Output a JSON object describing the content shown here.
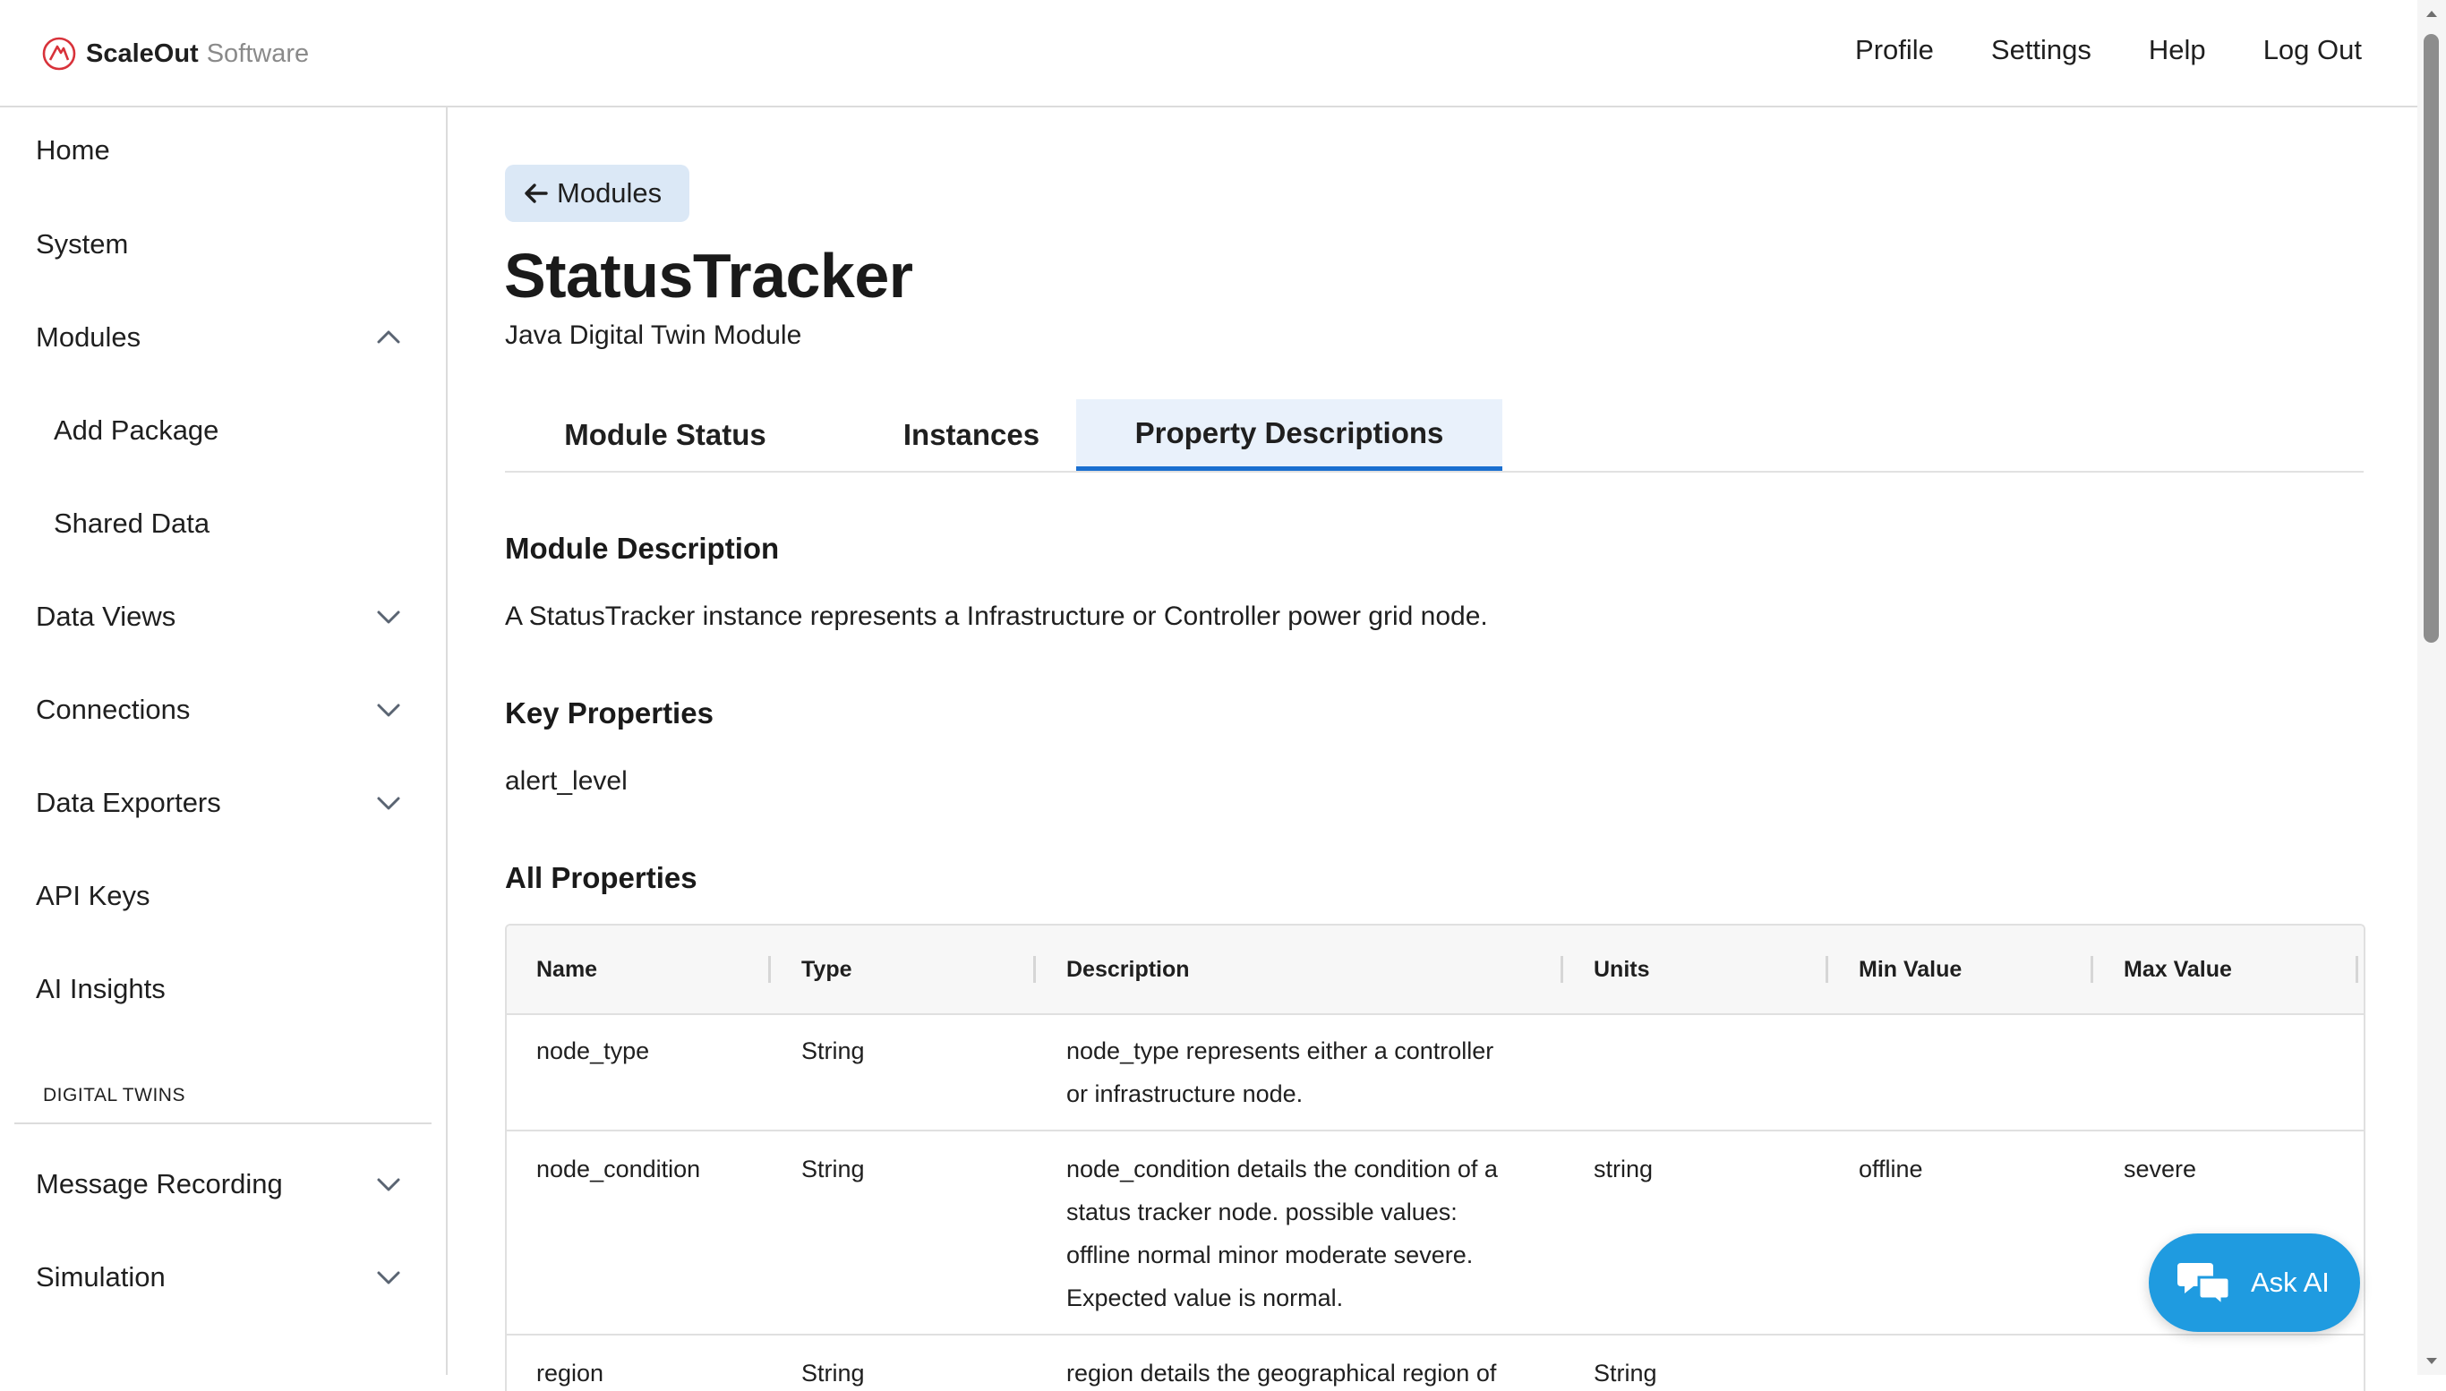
{
  "brand": {
    "name_bold": "ScaleOut",
    "name_light": "Software",
    "logo_color": "#d8323a"
  },
  "topnav": {
    "profile": "Profile",
    "settings": "Settings",
    "help": "Help",
    "logout": "Log Out"
  },
  "sidebar": {
    "items": [
      {
        "label": "Home"
      },
      {
        "label": "System"
      },
      {
        "label": "Modules",
        "expanded": true
      },
      {
        "label": "Add Package"
      },
      {
        "label": "Shared Data"
      },
      {
        "label": "Data Views"
      },
      {
        "label": "Connections"
      },
      {
        "label": "Data Exporters"
      },
      {
        "label": "API Keys"
      },
      {
        "label": "AI Insights"
      }
    ],
    "section_label": "DIGITAL TWINS",
    "section_items": [
      {
        "label": "Message Recording"
      },
      {
        "label": "Simulation"
      }
    ]
  },
  "main": {
    "back_label": "Modules",
    "title": "StatusTracker",
    "subtitle": "Java Digital Twin Module",
    "tabs": [
      {
        "label": "Module Status"
      },
      {
        "label": "Instances"
      },
      {
        "label": "Property Descriptions",
        "active": true
      }
    ],
    "module_description_heading": "Module Description",
    "module_description": "A StatusTracker instance represents a Infrastructure or Controller power grid node.",
    "key_properties_heading": "Key Properties",
    "key_properties": "alert_level",
    "all_properties_heading": "All Properties",
    "table": {
      "columns": [
        "Name",
        "Type",
        "Description",
        "Units",
        "Min Value",
        "Max Value"
      ],
      "rows": [
        {
          "name": "node_type",
          "type": "String",
          "description": [
            "node_type represents either a controller",
            "or infrastructure node."
          ],
          "units": "",
          "min": "",
          "max": ""
        },
        {
          "name": "node_condition",
          "type": "String",
          "description": [
            "node_condition details the condition of a",
            "status tracker node. possible values:",
            "offline normal minor moderate severe.",
            "Expected value is normal."
          ],
          "units": "string",
          "min": "offline",
          "max": "severe"
        },
        {
          "name": "region",
          "type": "String",
          "description": [
            "region details the geographical region of"
          ],
          "units": "String",
          "min": "",
          "max": ""
        }
      ]
    }
  },
  "ask_ai": {
    "label": "Ask AI",
    "color": "#1f9be0"
  },
  "colors": {
    "accent": "#1a6fd0",
    "active_tab_bg": "#e9f1fb",
    "back_button_bg": "#dbe8f6"
  }
}
